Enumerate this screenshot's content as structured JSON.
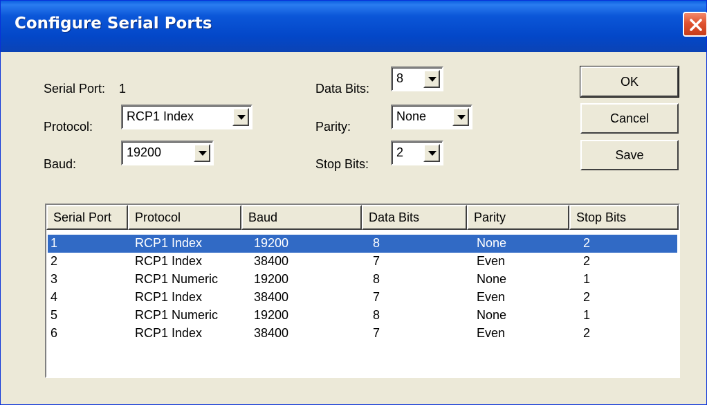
{
  "window": {
    "title": "Configure Serial Ports"
  },
  "form": {
    "serial_port_label": "Serial Port:",
    "serial_port_value": "1",
    "protocol_label": "Protocol:",
    "protocol_value": "RCP1 Index",
    "baud_label": "Baud:",
    "baud_value": "19200",
    "data_bits_label": "Data Bits:",
    "data_bits_value": "8",
    "parity_label": "Parity:",
    "parity_value": "None",
    "stop_bits_label": "Stop Bits:",
    "stop_bits_value": "2"
  },
  "buttons": {
    "ok": "OK",
    "cancel": "Cancel",
    "save": "Save"
  },
  "table": {
    "headers": [
      "Serial Port",
      "Protocol",
      "Baud",
      "Data Bits",
      "Parity",
      "Stop Bits"
    ],
    "rows": [
      [
        "1",
        "RCP1 Index",
        "19200",
        "8",
        "None",
        "2"
      ],
      [
        "2",
        "RCP1 Index",
        "38400",
        "7",
        "Even",
        "2"
      ],
      [
        "3",
        "RCP1 Numeric",
        "19200",
        "8",
        "None",
        "1"
      ],
      [
        "4",
        "RCP1 Index",
        "38400",
        "7",
        "Even",
        "2"
      ],
      [
        "5",
        "RCP1 Numeric",
        "19200",
        "8",
        "None",
        "1"
      ],
      [
        "6",
        "RCP1 Index",
        "38400",
        "7",
        "Even",
        "2"
      ]
    ],
    "selected_row": 0
  },
  "colors": {
    "titlebar": "#0347c8",
    "selection": "#316ac5",
    "face": "#ece9d8"
  }
}
